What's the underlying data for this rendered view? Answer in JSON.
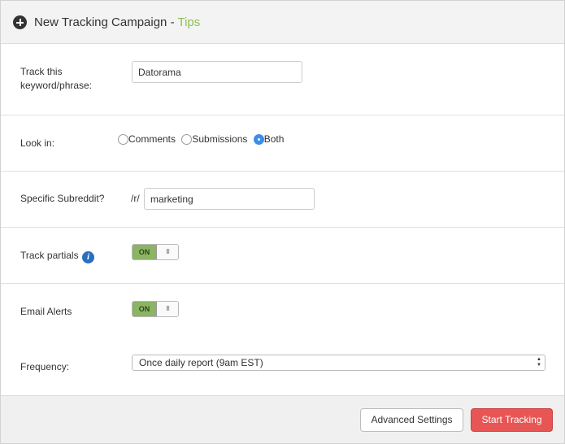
{
  "header": {
    "title": "New Tracking Campaign - ",
    "tips_link": "Tips",
    "icon": "plus-circle-icon"
  },
  "keyword": {
    "label_line1": "Track this",
    "label_line2": "keyword/phrase:",
    "value": "Datorama"
  },
  "look_in": {
    "label": "Look in:",
    "options": [
      "Comments",
      "Submissions",
      "Both"
    ],
    "selected": "Both"
  },
  "subreddit": {
    "label": "Specific Subreddit?",
    "prefix": "/r/",
    "value": "marketing"
  },
  "track_partials": {
    "label": "Track partials",
    "toggle_on": "ON",
    "toggle_grip": "III",
    "state": "on",
    "info_icon": "info-icon"
  },
  "email_alerts": {
    "label": "Email Alerts",
    "toggle_on": "ON",
    "toggle_grip": "III",
    "state": "on"
  },
  "frequency": {
    "label": "Frequency:",
    "selected": "Once daily report (9am EST)"
  },
  "footer": {
    "advanced_label": "Advanced Settings",
    "start_label": "Start Tracking"
  },
  "colors": {
    "accent_green": "#8cc152",
    "toggle_green": "#8cb464",
    "primary_red": "#e75555",
    "radio_blue": "#3b8ee8"
  }
}
